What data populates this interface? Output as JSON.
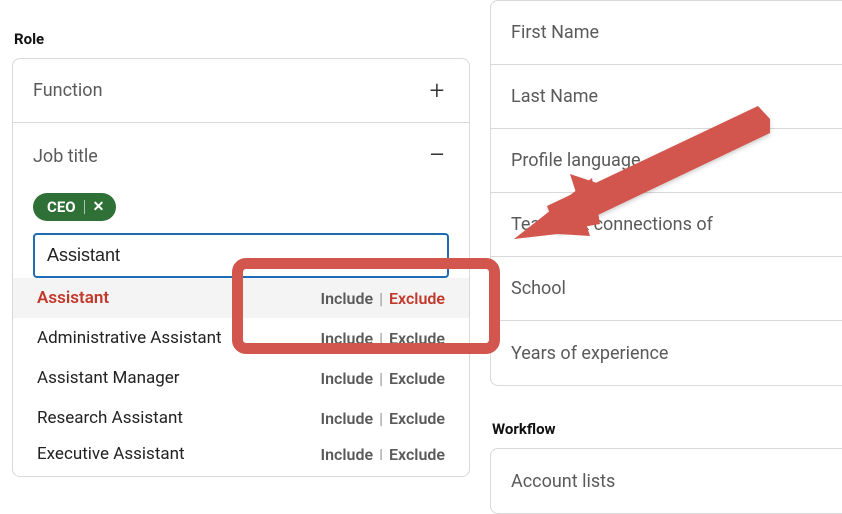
{
  "left": {
    "section": "Role",
    "function": {
      "label": "Function",
      "expanded": false
    },
    "jobtitle": {
      "label": "Job title",
      "expanded": true,
      "chips": [
        {
          "text": "CEO"
        }
      ],
      "input_value": "Assistant",
      "suggestions": [
        {
          "label": "Assistant",
          "include": "Include",
          "exclude": "Exclude",
          "selected": true
        },
        {
          "label": "Administrative Assistant",
          "include": "Include",
          "exclude": "Exclude",
          "selected": false
        },
        {
          "label": "Assistant Manager",
          "include": "Include",
          "exclude": "Exclude",
          "selected": false
        },
        {
          "label": "Research Assistant",
          "include": "Include",
          "exclude": "Exclude",
          "selected": false
        },
        {
          "label": "Executive Assistant",
          "include": "Include",
          "exclude": "Exclude",
          "selected": false
        }
      ]
    }
  },
  "right": {
    "filters": [
      {
        "label": "First Name"
      },
      {
        "label": "Last Name"
      },
      {
        "label": "Profile language"
      },
      {
        "label": "TeamLink connections of"
      },
      {
        "label": "School"
      },
      {
        "label": "Years of experience"
      }
    ],
    "workflow_label": "Workflow",
    "workflow_rows": [
      {
        "label": "Account lists"
      }
    ]
  }
}
